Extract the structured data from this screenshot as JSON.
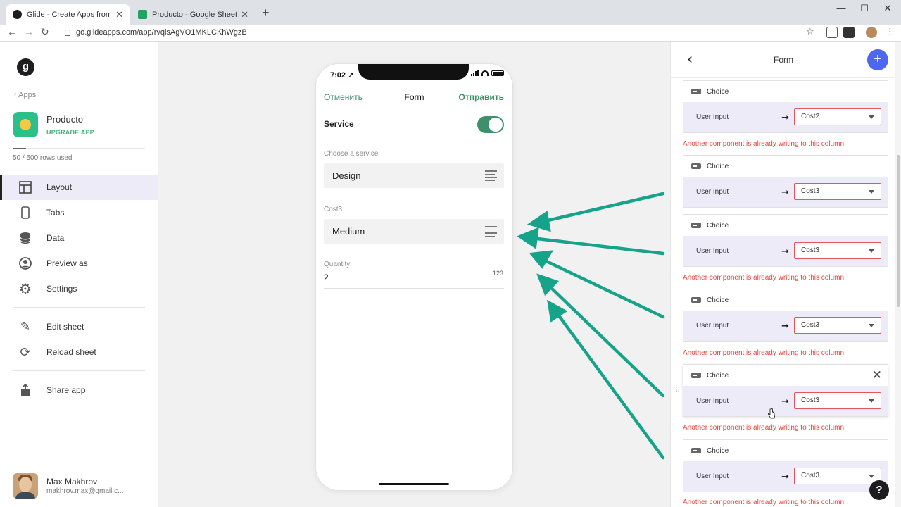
{
  "browser": {
    "tabs": [
      {
        "title": "Glide - Create Apps from Google",
        "fav_color": "#1d1d1f"
      },
      {
        "title": "Producto - Google Sheets",
        "fav_color": "#1fa463"
      }
    ],
    "url": "go.glideapps.com/app/rvqisAgVO1MKLCKhWgzB"
  },
  "sidebar": {
    "logo": "g",
    "back_label": "Apps",
    "app_name": "Producto",
    "upgrade_label": "UPGRADE APP",
    "rows_used": "50 / 500 rows used",
    "rows_fraction": 0.1,
    "menu": [
      {
        "label": "Layout",
        "icon": "layout-icon"
      },
      {
        "label": "Tabs",
        "icon": "phone-icon"
      },
      {
        "label": "Data",
        "icon": "database-icon"
      },
      {
        "label": "Preview as",
        "icon": "user-circle-icon"
      },
      {
        "label": "Settings",
        "icon": "gear-icon"
      },
      {
        "label": "Edit sheet",
        "icon": "pencil-icon"
      },
      {
        "label": "Reload sheet",
        "icon": "refresh-icon"
      },
      {
        "label": "Share app",
        "icon": "share-icon"
      }
    ],
    "user": {
      "name": "Max Makhrov",
      "email": "makhrov.max@gmail.c..."
    }
  },
  "phone": {
    "time": "7:02",
    "cancel": "Отменить",
    "title": "Form",
    "send": "Отправить",
    "service_label": "Service",
    "service_on": true,
    "choose_label": "Choose a service",
    "choose_value": "Design",
    "cost3_label": "Cost3",
    "cost3_value": "Medium",
    "quantity_label": "Quantity",
    "quantity_value": "2",
    "quantity_hint": "123"
  },
  "panel": {
    "title": "Form",
    "add": "+",
    "cards": [
      {
        "type": "Choice",
        "input_label": "User Input",
        "column": "Cost2",
        "error": "Another component is already writing to this column"
      },
      {
        "type": "Choice",
        "input_label": "User Input",
        "column": "Cost3",
        "error": ""
      },
      {
        "type": "Choice",
        "input_label": "User Input",
        "column": "Cost3",
        "error": "Another component is already writing to this column"
      },
      {
        "type": "Choice",
        "input_label": "User Input",
        "column": "Cost3",
        "error": "Another component is already writing to this column"
      },
      {
        "type": "Choice",
        "input_label": "User Input",
        "column": "Cost3",
        "error": "Another component is already writing to this column"
      },
      {
        "type": "Choice",
        "input_label": "User Input",
        "column": "Cost3",
        "error": "Another component is already writing to this column"
      }
    ],
    "help": "?"
  },
  "colors": {
    "accent_green": "#3f8f6c",
    "annotation_arrow": "#16a38a",
    "error": "#e4473f",
    "add_button": "#4f66ef"
  }
}
